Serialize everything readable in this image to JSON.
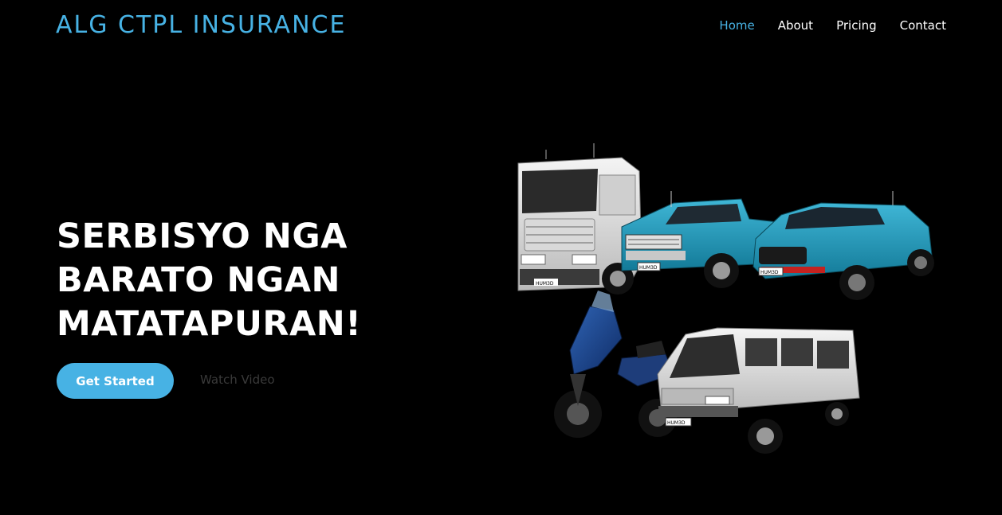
{
  "header": {
    "brand": "ALG CTPL INSURANCE",
    "nav": [
      {
        "label": "Home",
        "active": true
      },
      {
        "label": "About",
        "active": false
      },
      {
        "label": "Pricing",
        "active": false
      },
      {
        "label": "Contact",
        "active": false
      }
    ]
  },
  "hero": {
    "headline_lines": [
      "SERBISYO NGA",
      "BARATO NGAN",
      "MATATAPURAN!"
    ],
    "cta_label": "Get Started",
    "secondary_label": "Watch Video",
    "image": {
      "plates": {
        "truck": "HUM3D",
        "pickup": "HUM3D",
        "suv": "HUM3D",
        "van": "HUM3D"
      }
    }
  },
  "colors": {
    "accent": "#47b2e4",
    "background": "#000000",
    "secondary_text": "#3a3a3a"
  }
}
